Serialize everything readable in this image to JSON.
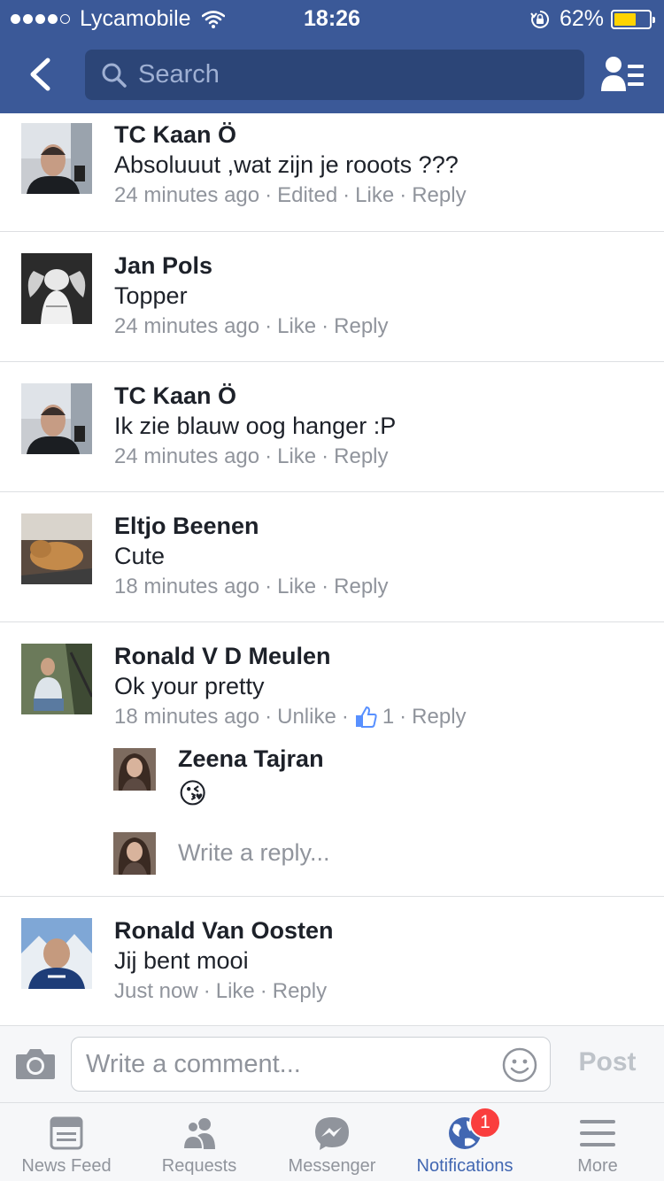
{
  "status_bar": {
    "carrier": "Lycamobile",
    "time": "18:26",
    "battery_percent": "62%",
    "battery_level": 0.62,
    "signal_bars_filled": 4,
    "signal_bars_total": 5
  },
  "header": {
    "search_placeholder": "Search",
    "background_color": "#3b5998"
  },
  "comments": [
    {
      "author": "TC Kaan Ö",
      "text": "Absoluuut ,wat zijn je rooots ???",
      "time": "24 minutes ago",
      "edited_label": "Edited",
      "like_label": "Like",
      "reply_label": "Reply"
    },
    {
      "author": "Jan Pols",
      "text": "Topper",
      "time": "24 minutes ago",
      "like_label": "Like",
      "reply_label": "Reply"
    },
    {
      "author": "TC Kaan Ö",
      "text": "Ik zie blauw oog hanger :P",
      "time": "24 minutes ago",
      "like_label": "Like",
      "reply_label": "Reply"
    },
    {
      "author": "Eltjo Beenen",
      "text": "Cute",
      "time": "18 minutes ago",
      "like_label": "Like",
      "reply_label": "Reply"
    },
    {
      "author": "Ronald V D Meulen",
      "text": "Ok your pretty",
      "time": "18 minutes ago",
      "like_label": "Unlike",
      "like_count": "1",
      "reply_label": "Reply",
      "reply": {
        "author": "Zeena Tajran",
        "emoji": "😘"
      },
      "reply_placeholder": "Write a reply..."
    },
    {
      "author": "Ronald Van Oosten",
      "text": "Jij bent mooi",
      "time": "Just now",
      "like_label": "Like",
      "reply_label": "Reply"
    }
  ],
  "composer": {
    "placeholder": "Write a comment...",
    "post_label": "Post"
  },
  "tabbar": {
    "tabs": [
      {
        "label": "News Feed",
        "icon": "news-feed-icon"
      },
      {
        "label": "Requests",
        "icon": "friend-requests-icon"
      },
      {
        "label": "Messenger",
        "icon": "messenger-icon"
      },
      {
        "label": "Notifications",
        "icon": "globe-icon",
        "badge": "1",
        "active": true
      },
      {
        "label": "More",
        "icon": "menu-icon"
      }
    ]
  },
  "colors": {
    "brand_blue": "#3b5998",
    "link_gray": "#90949c",
    "active_tab": "#4267b2",
    "badge_red": "#fa3e3e"
  }
}
